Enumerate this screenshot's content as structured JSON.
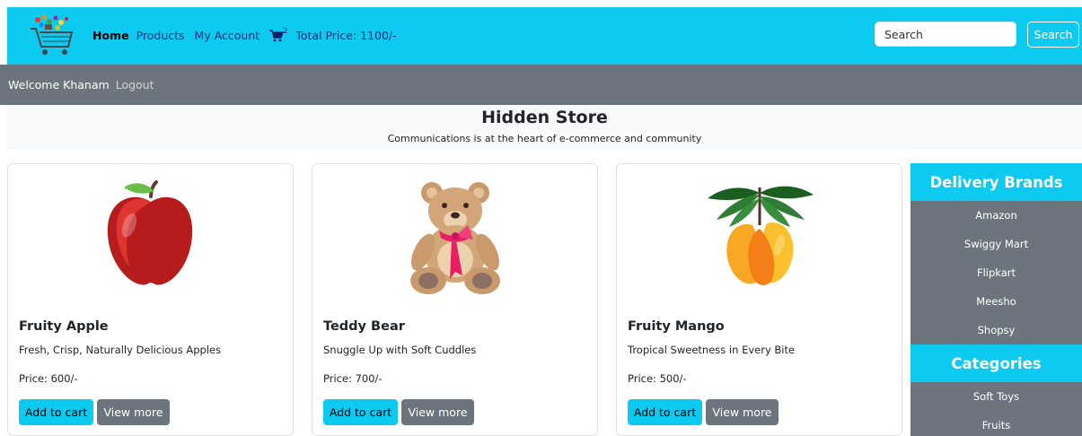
{
  "header": {
    "nav": {
      "home": "Home",
      "products": "Products",
      "account": "My Account"
    },
    "cart_count": "2",
    "total_price": "Total Price: 1100/-",
    "search": {
      "placeholder": "Search",
      "button": "Search"
    }
  },
  "subbar": {
    "welcome": "Welcome Khanam",
    "logout": "Logout"
  },
  "hero": {
    "title": "Hidden Store",
    "tagline": "Communications is at the heart of e-commerce and community"
  },
  "products": [
    {
      "title": "Fruity Apple",
      "desc": "Fresh, Crisp, Naturally Delicious Apples",
      "price": "Price: 600/-",
      "add": "Add to cart",
      "more": "View more"
    },
    {
      "title": "Teddy Bear",
      "desc": "Snuggle Up with Soft Cuddles",
      "price": "Price: 700/-",
      "add": "Add to cart",
      "more": "View more"
    },
    {
      "title": "Fruity Mango",
      "desc": "Tropical Sweetness in Every Bite",
      "price": "Price: 500/-",
      "add": "Add to cart",
      "more": "View more"
    }
  ],
  "sidebar": {
    "brands_heading": "Delivery Brands",
    "brands": [
      "Amazon",
      "Swiggy Mart",
      "Flipkart",
      "Meesho",
      "Shopsy"
    ],
    "categories_heading": "Categories",
    "categories": [
      "Soft Toys",
      "Fruits"
    ]
  },
  "colors": {
    "accent": "#0dcaf0",
    "secondary": "#6c757d",
    "hero_bg": "#f8f9fa"
  },
  "icons": {
    "logo": "shopping-cart-logo-icon",
    "cart": "cart-icon"
  }
}
